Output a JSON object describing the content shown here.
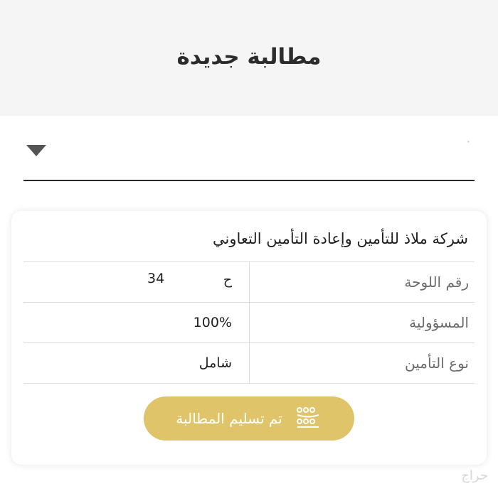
{
  "header": {
    "title": "مطالبة جديدة"
  },
  "select": {
    "value": "·"
  },
  "card": {
    "company_name": "شركة ملاذ للتأمين وإعادة التأمين التعاوني",
    "rows": {
      "plate": {
        "label": "رقم اللوحة",
        "letter": "ح",
        "number": "34"
      },
      "liability": {
        "label": "المسؤولية",
        "value": "100%"
      },
      "insurance_type": {
        "label": "نوع التأمين",
        "value": "شامل"
      }
    },
    "status_button": {
      "label": "تم تسليم المطالبة",
      "icon": "claim-status-icon"
    }
  },
  "colors": {
    "accent": "#dfc46a",
    "header_bg": "#f5f5f5"
  },
  "watermark": "حراج"
}
